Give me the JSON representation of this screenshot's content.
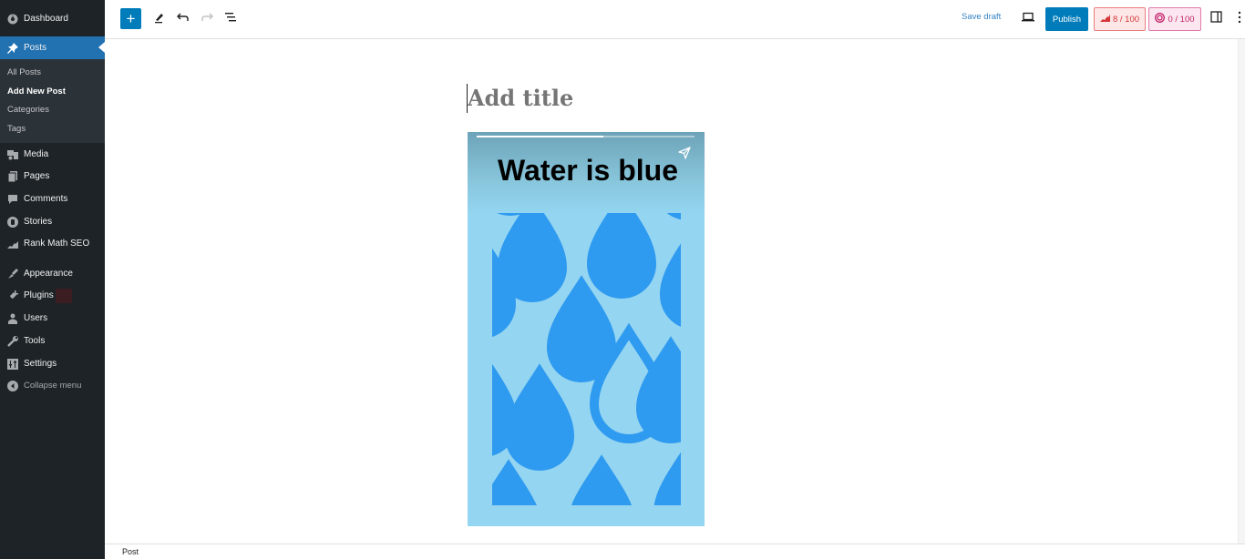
{
  "sidebar": {
    "items": [
      {
        "label": "Dashboard",
        "icon": "dashboard-icon"
      },
      {
        "label": "Posts",
        "icon": "pin-icon",
        "active": true
      },
      {
        "label": "Media",
        "icon": "media-icon"
      },
      {
        "label": "Pages",
        "icon": "pages-icon"
      },
      {
        "label": "Comments",
        "icon": "comment-icon"
      },
      {
        "label": "Stories",
        "icon": "stories-icon"
      },
      {
        "label": "Rank Math SEO",
        "icon": "rank-math-icon"
      },
      {
        "label": "Appearance",
        "icon": "brush-icon"
      },
      {
        "label": "Plugins",
        "icon": "plugin-icon"
      },
      {
        "label": "Users",
        "icon": "user-icon"
      },
      {
        "label": "Tools",
        "icon": "wrench-icon"
      },
      {
        "label": "Settings",
        "icon": "settings-icon"
      },
      {
        "label": "Collapse menu",
        "icon": "collapse-icon"
      }
    ],
    "submenu": [
      {
        "label": "All Posts"
      },
      {
        "label": "Add New Post",
        "current": true
      },
      {
        "label": "Categories"
      },
      {
        "label": "Tags"
      }
    ]
  },
  "toolbar": {
    "inserter_label": "+",
    "save_draft": "Save draft",
    "publish": "Publish",
    "seo_score": "8 / 100",
    "content_score": "0 / 100"
  },
  "editor": {
    "title_placeholder": "Add title",
    "story": {
      "title": "Water is blue",
      "progress_fraction": 0.58
    }
  },
  "footer": {
    "breadcrumb": "Post"
  },
  "colors": {
    "accent": "#007cba",
    "sidebar_bg": "#1d2327",
    "active_menu": "#2271b1",
    "story_bg": "#94d5f1",
    "drop": "#2e9af0"
  }
}
